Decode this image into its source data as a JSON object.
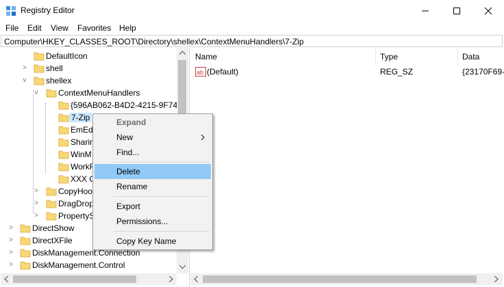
{
  "window": {
    "title": "Registry Editor"
  },
  "menu": [
    "File",
    "Edit",
    "View",
    "Favorites",
    "Help"
  ],
  "address": "Computer\\HKEY_CLASSES_ROOT\\Directory\\shellex\\ContextMenuHandlers\\7-Zip",
  "tree": [
    {
      "label": "DefaultIcon",
      "arrow": ""
    },
    {
      "label": "shell",
      "arrow": ">"
    },
    {
      "label": "shellex",
      "arrow": "v"
    },
    {
      "label": "ContextMenuHandlers",
      "arrow": "v"
    },
    {
      "label": "{596AB062-B4D2-4215-9F74-",
      "arrow": ""
    },
    {
      "label": "7-Zip",
      "arrow": ""
    },
    {
      "label": "EmEd",
      "arrow": ""
    },
    {
      "label": "Sharin",
      "arrow": ""
    },
    {
      "label": "WinM",
      "arrow": ""
    },
    {
      "label": "WorkF",
      "arrow": ""
    },
    {
      "label": "XXX G",
      "arrow": ""
    },
    {
      "label": "CopyHoo",
      "arrow": ">"
    },
    {
      "label": "DragDrop",
      "arrow": ">"
    },
    {
      "label": "PropertyS",
      "arrow": ">"
    },
    {
      "label": "DirectShow",
      "arrow": ">"
    },
    {
      "label": "DirectXFile",
      "arrow": ">"
    },
    {
      "label": "DiskManagement.Connection",
      "arrow": ">"
    },
    {
      "label": "DiskManagement.Control",
      "arrow": ">"
    }
  ],
  "columns": [
    "Name",
    "Type",
    "Data"
  ],
  "values": [
    {
      "name": "(Default)",
      "type": "REG_SZ",
      "data": "{23170F69-"
    }
  ],
  "context_menu": {
    "expand": "Expand",
    "new": "New",
    "find": "Find...",
    "delete": "Delete",
    "rename": "Rename",
    "export": "Export",
    "permissions": "Permissions...",
    "copy_key_name": "Copy Key Name"
  },
  "colors": {
    "selection": "#cce8ff",
    "menu_highlight": "#91c9f7",
    "folder": "#f8d775"
  }
}
